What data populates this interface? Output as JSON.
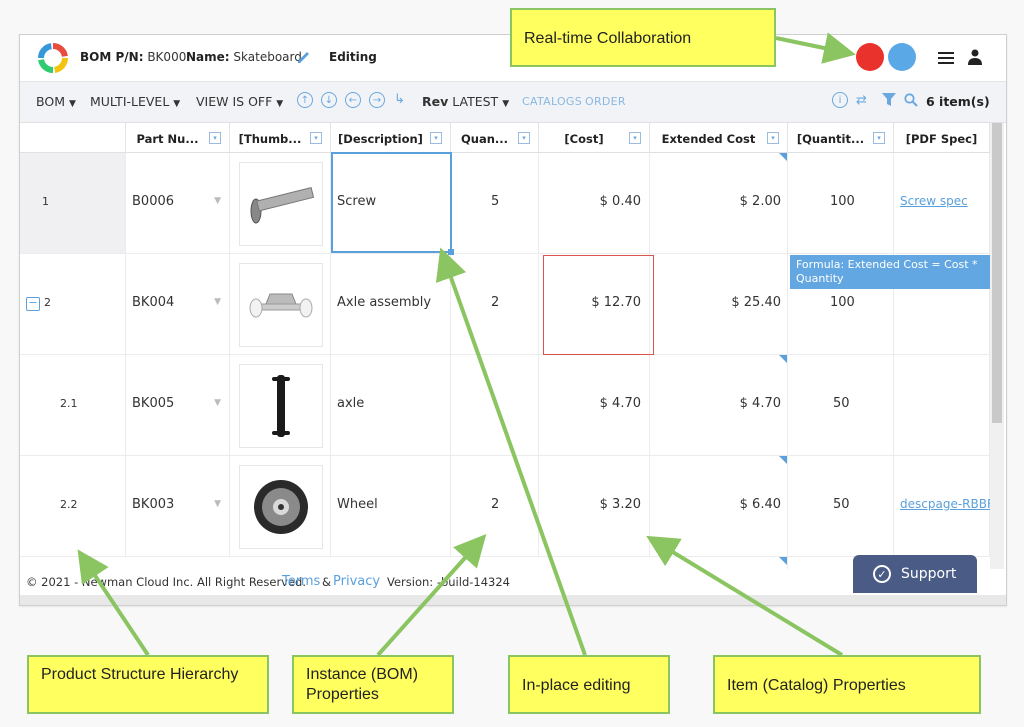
{
  "header": {
    "bom_pn_label": "BOM P/N:",
    "bom_pn_value": "BK000",
    "name_label": "Name:",
    "name_value": "Skateboard",
    "mode": "Editing",
    "avatar_colors": [
      "#e8322b",
      "#5aa9e6"
    ]
  },
  "toolbar": {
    "bom": "BOM",
    "multi_level": "MULTI-LEVEL",
    "view": "VIEW IS OFF",
    "rev_label": "Rev",
    "rev_value": "LATEST",
    "catalogs": "CATALOGS",
    "order": "ORDER",
    "items_count": "6 item(s)"
  },
  "columns": [
    "Part Nu...",
    "[Thumb...",
    "[Description]",
    "Quan...",
    "[Cost]",
    "Extended Cost",
    "[Quantit...",
    "[PDF Spec]"
  ],
  "rows": [
    {
      "index": "1",
      "part": "B0006",
      "thumb": "screw",
      "description": "Screw",
      "quantity": "5",
      "cost": "$ 0.40",
      "extended": "$ 2.00",
      "qty2": "100",
      "pdf": "Screw spec"
    },
    {
      "index": "2",
      "part": "BK004",
      "thumb": "truck",
      "description": "Axle assembly",
      "quantity": "2",
      "cost": "$ 12.70",
      "extended": "$ 25.40",
      "qty2": "100",
      "pdf": ""
    },
    {
      "index": "2.1",
      "part": "BK005",
      "thumb": "axle",
      "description": "axle",
      "quantity": "",
      "cost": "$ 4.70",
      "extended": "$ 4.70",
      "qty2": "50",
      "pdf": ""
    },
    {
      "index": "2.2",
      "part": "BK003",
      "thumb": "wheel",
      "description": "Wheel",
      "quantity": "2",
      "cost": "$ 3.20",
      "extended": "$ 6.40",
      "qty2": "50",
      "pdf": "descpage-RBBR."
    }
  ],
  "tooltip": "Formula: Extended Cost = Cost * Quantity",
  "footer": {
    "copyright": "© 2021 - Newman Cloud Inc. All Right Reserved.",
    "terms": "Terms",
    "amp": "&",
    "privacy": "Privacy",
    "version": "Version: -build-14324"
  },
  "support": "Support",
  "callouts": {
    "realtime": "Real-time Collaboration",
    "hierarchy": "Product Structure Hierarchy",
    "instance": "Instance (BOM) Properties",
    "inplace": "In-place editing",
    "item": "Item (Catalog) Properties"
  },
  "accent_color": "#5aa0dc",
  "callout_color": "#ffff5f",
  "arrow_color": "#8bc561"
}
